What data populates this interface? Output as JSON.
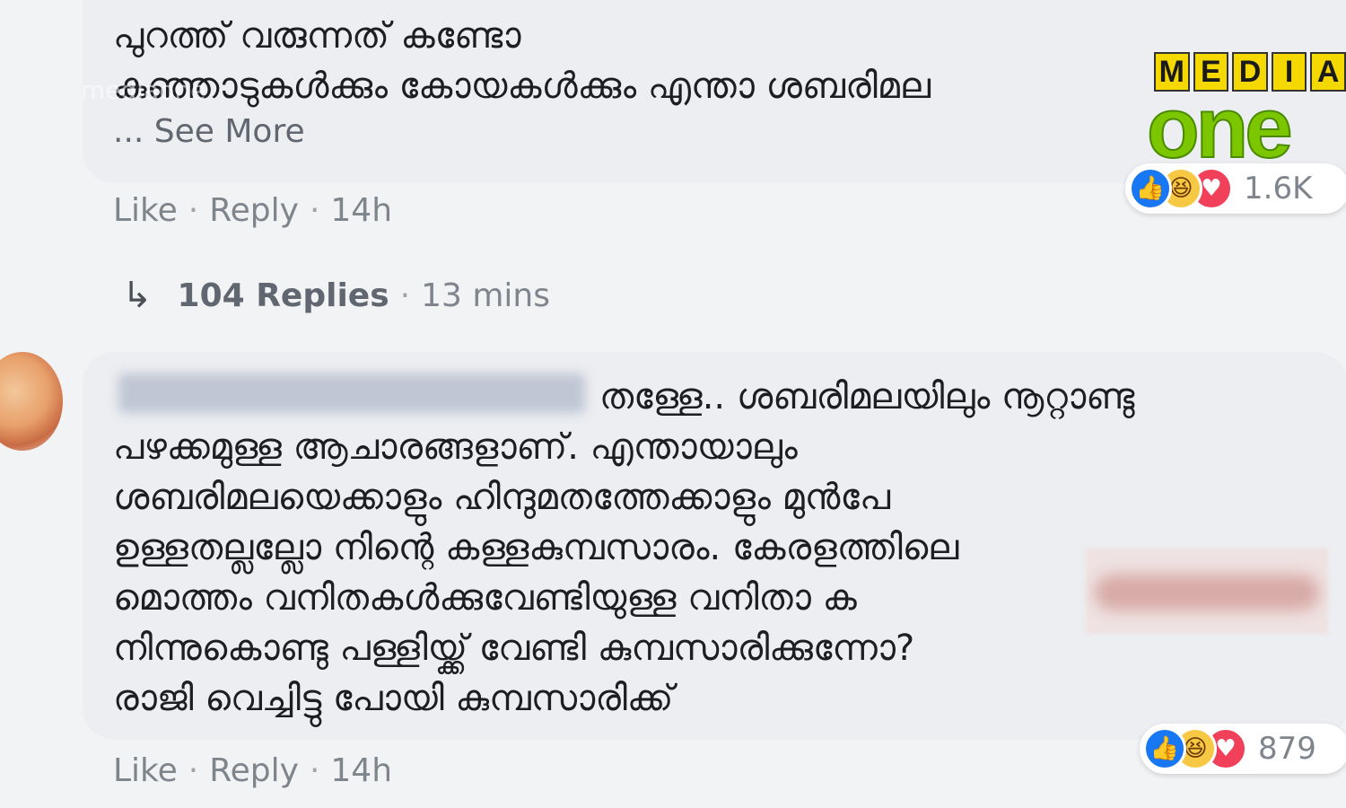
{
  "comment1": {
    "lines": [
      "പുറത്ത് വരുന്നത് കണ്ടോ",
      "കുഞ്ഞാടുകൾക്കും കോയകൾക്കും എന്താ ശബരിമല"
    ],
    "see_more": "... See More",
    "actions": {
      "like": "Like",
      "sep": "·",
      "reply": "Reply",
      "time": "14h"
    },
    "reaction_count": "1.6K"
  },
  "replies": {
    "arrow": "↳",
    "count": "104 Replies",
    "sep": "·",
    "time": "13 mins"
  },
  "comment2": {
    "lines": [
      "തള്ളേ.. ശബരിമലയിലും നൂറ്റാണ്ടു",
      "പഴക്കമുള്ള ആചാരങ്ങളാണ്. എന്തായാലും",
      "ശബരിമലയെക്കാളും ഹിന്ദുമതത്തേക്കാളും മുൻപേ",
      "ഉള്ളതല്ലല്ലോ നിന്റെ കള്ളകുമ്പസാരം. കേരളത്തിലെ",
      "മൊത്തം വനിതകൾക്കുവേണ്ടിയുള്ള വനിതാ ക",
      "നിന്നുകൊണ്ടു പള്ളിയ്ക്ക് വേണ്ടി കുമ്പസാരിക്കുന്നോ?",
      "രാജി വെച്ചിട്ടു പോയി കുമ്പസാരിക്ക്"
    ],
    "actions": {
      "like": "Like",
      "sep": "·",
      "reply": "Reply",
      "time": "14h"
    },
    "reaction_count": "879"
  },
  "icons": {
    "like": "like-icon",
    "haha": "haha-icon",
    "love": "love-icon",
    "reply_arrow": "reply-arrow-icon"
  },
  "watermark": {
    "logo_top": [
      "M",
      "E",
      "D",
      "I",
      "A"
    ],
    "logo_bottom": "one",
    "faint_text": "mediaone"
  },
  "colors": {
    "like": "#1877f2",
    "haha": "#f7c843",
    "love": "#f0405a",
    "logo_green": "#7cc600",
    "logo_yellow": "#f5d800"
  }
}
